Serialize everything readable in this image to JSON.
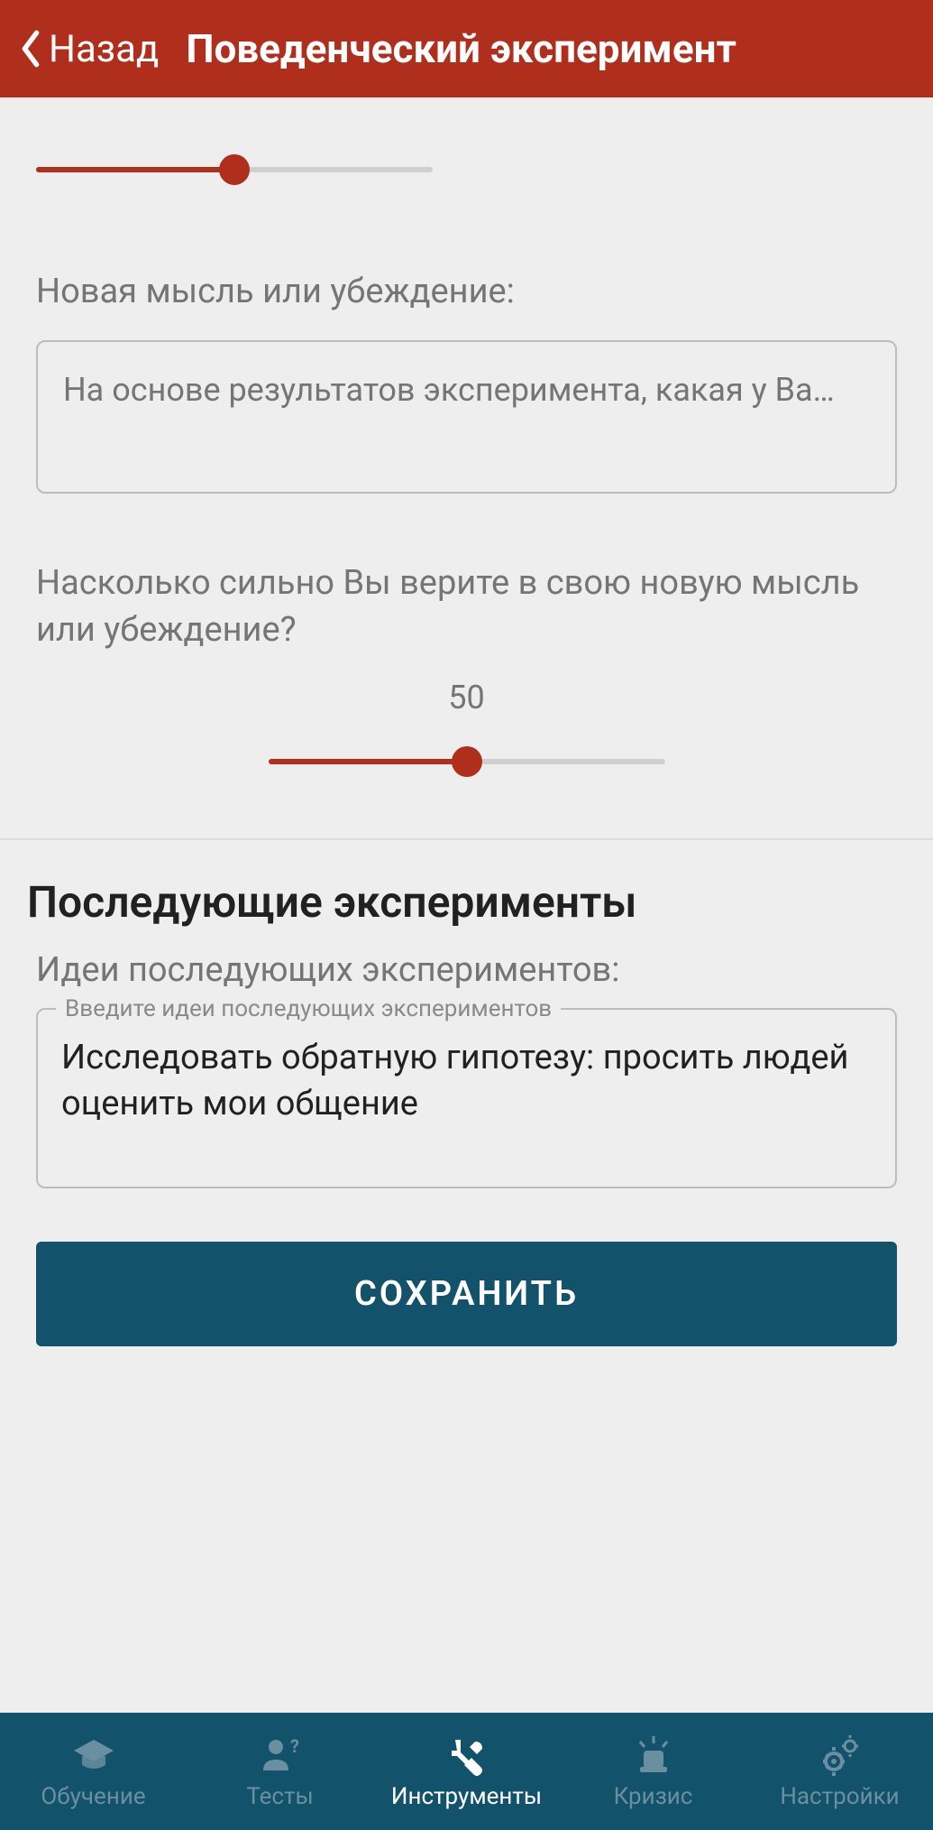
{
  "header": {
    "back_label": "Назад",
    "title": "Поведенческий эксперимент"
  },
  "slider1": {
    "value": 50,
    "max": 100
  },
  "new_thought": {
    "label": "Новая мысль или убеждение:",
    "placeholder": "На основе результатов эксперимента, какая у Ва…"
  },
  "belief_question": "Насколько сильно Вы верите в свою новую мысль или убеждение?",
  "slider2": {
    "display": "50",
    "value": 50,
    "max": 100
  },
  "followup": {
    "section_title": "Последующие эксперименты",
    "label": "Идеи последующих экспериментов:",
    "floating_label": "Введите идеи последующих экспериментов",
    "value": "Исследовать обратную гипотезу: просить людей оценить мои общение"
  },
  "save_label": "СОХРАНИТЬ",
  "nav": {
    "items": [
      {
        "label": "Обучение"
      },
      {
        "label": "Тесты"
      },
      {
        "label": "Инструменты"
      },
      {
        "label": "Кризис"
      },
      {
        "label": "Настройки"
      }
    ]
  }
}
